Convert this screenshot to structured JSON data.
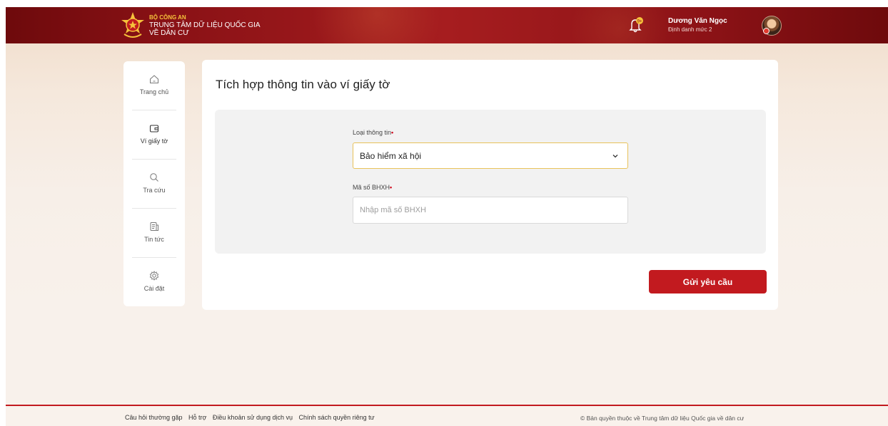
{
  "header": {
    "org_line1": "BỘ CÔNG AN",
    "org_line2": "TRUNG TÂM DỮ LIỆU QUỐC GIA",
    "org_line3": "VỀ DÂN CƯ",
    "user_name": "Dương Văn Ngọc",
    "user_level": "Định danh mức 2",
    "bell_icon": "bell-icon",
    "brand_red": "#8b1216"
  },
  "sidebar": {
    "items": [
      {
        "label": "Trang chủ",
        "icon": "home-icon"
      },
      {
        "label": "Ví giấy tờ",
        "icon": "wallet-icon"
      },
      {
        "label": "Tra cứu",
        "icon": "search-icon"
      },
      {
        "label": "Tin tức",
        "icon": "news-icon"
      },
      {
        "label": "Cài đặt",
        "icon": "gear-icon"
      }
    ],
    "active": "Ví giấy tờ"
  },
  "main": {
    "title": "Tích hợp thông tin vào ví giấy tờ",
    "info_type_label": "Loại thông tin",
    "info_type_value": "Bảo hiểm xã hội",
    "code_label": "Mã số BHXH",
    "code_placeholder": "Nhập mã số BHXH",
    "code_value": "",
    "submit_label": "Gửi yêu cầu",
    "required_mark": "•"
  },
  "footer": {
    "links": [
      "Câu hỏi thường gặp",
      "Hỗ trợ",
      "Điều khoản sử dụng dịch vụ",
      "Chính sách quyền riêng tư"
    ],
    "copyright": "© Bản quyền thuộc về Trung tâm dữ liệu Quốc gia về dân cư"
  }
}
